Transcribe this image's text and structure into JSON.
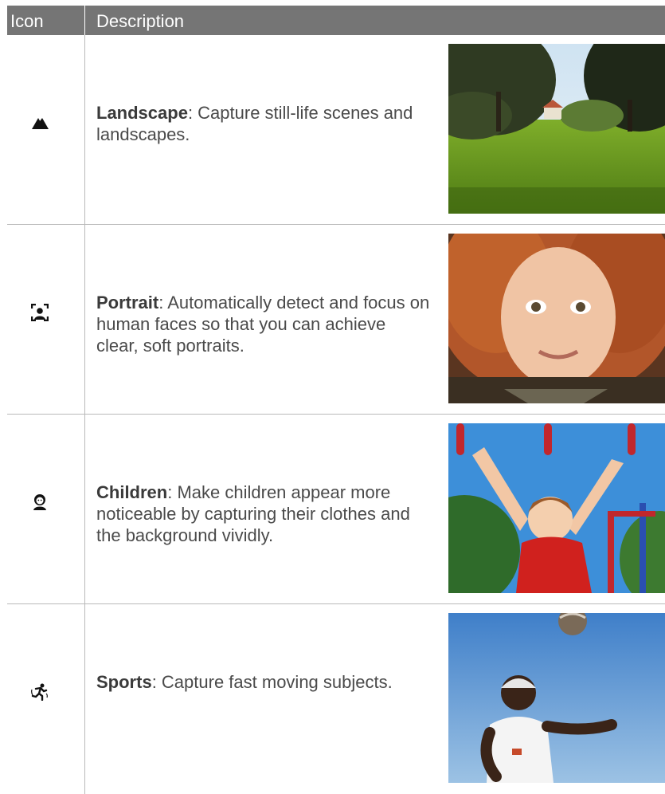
{
  "header": {
    "icon": "Icon",
    "description": "Description"
  },
  "rows": [
    {
      "icon": "landscape-icon",
      "title": "Landscape",
      "text": ": Capture still-life scenes and landscapes."
    },
    {
      "icon": "portrait-icon",
      "title": "Portrait",
      "text": ": Automatically detect and focus on human faces so that you can achieve clear, soft portraits."
    },
    {
      "icon": "children-icon",
      "title": "Children",
      "text": ": Make children appear more noticeable by capturing their clothes and the background vividly."
    },
    {
      "icon": "sports-icon",
      "title": "Sports",
      "text": ": Capture fast moving subjects."
    }
  ]
}
